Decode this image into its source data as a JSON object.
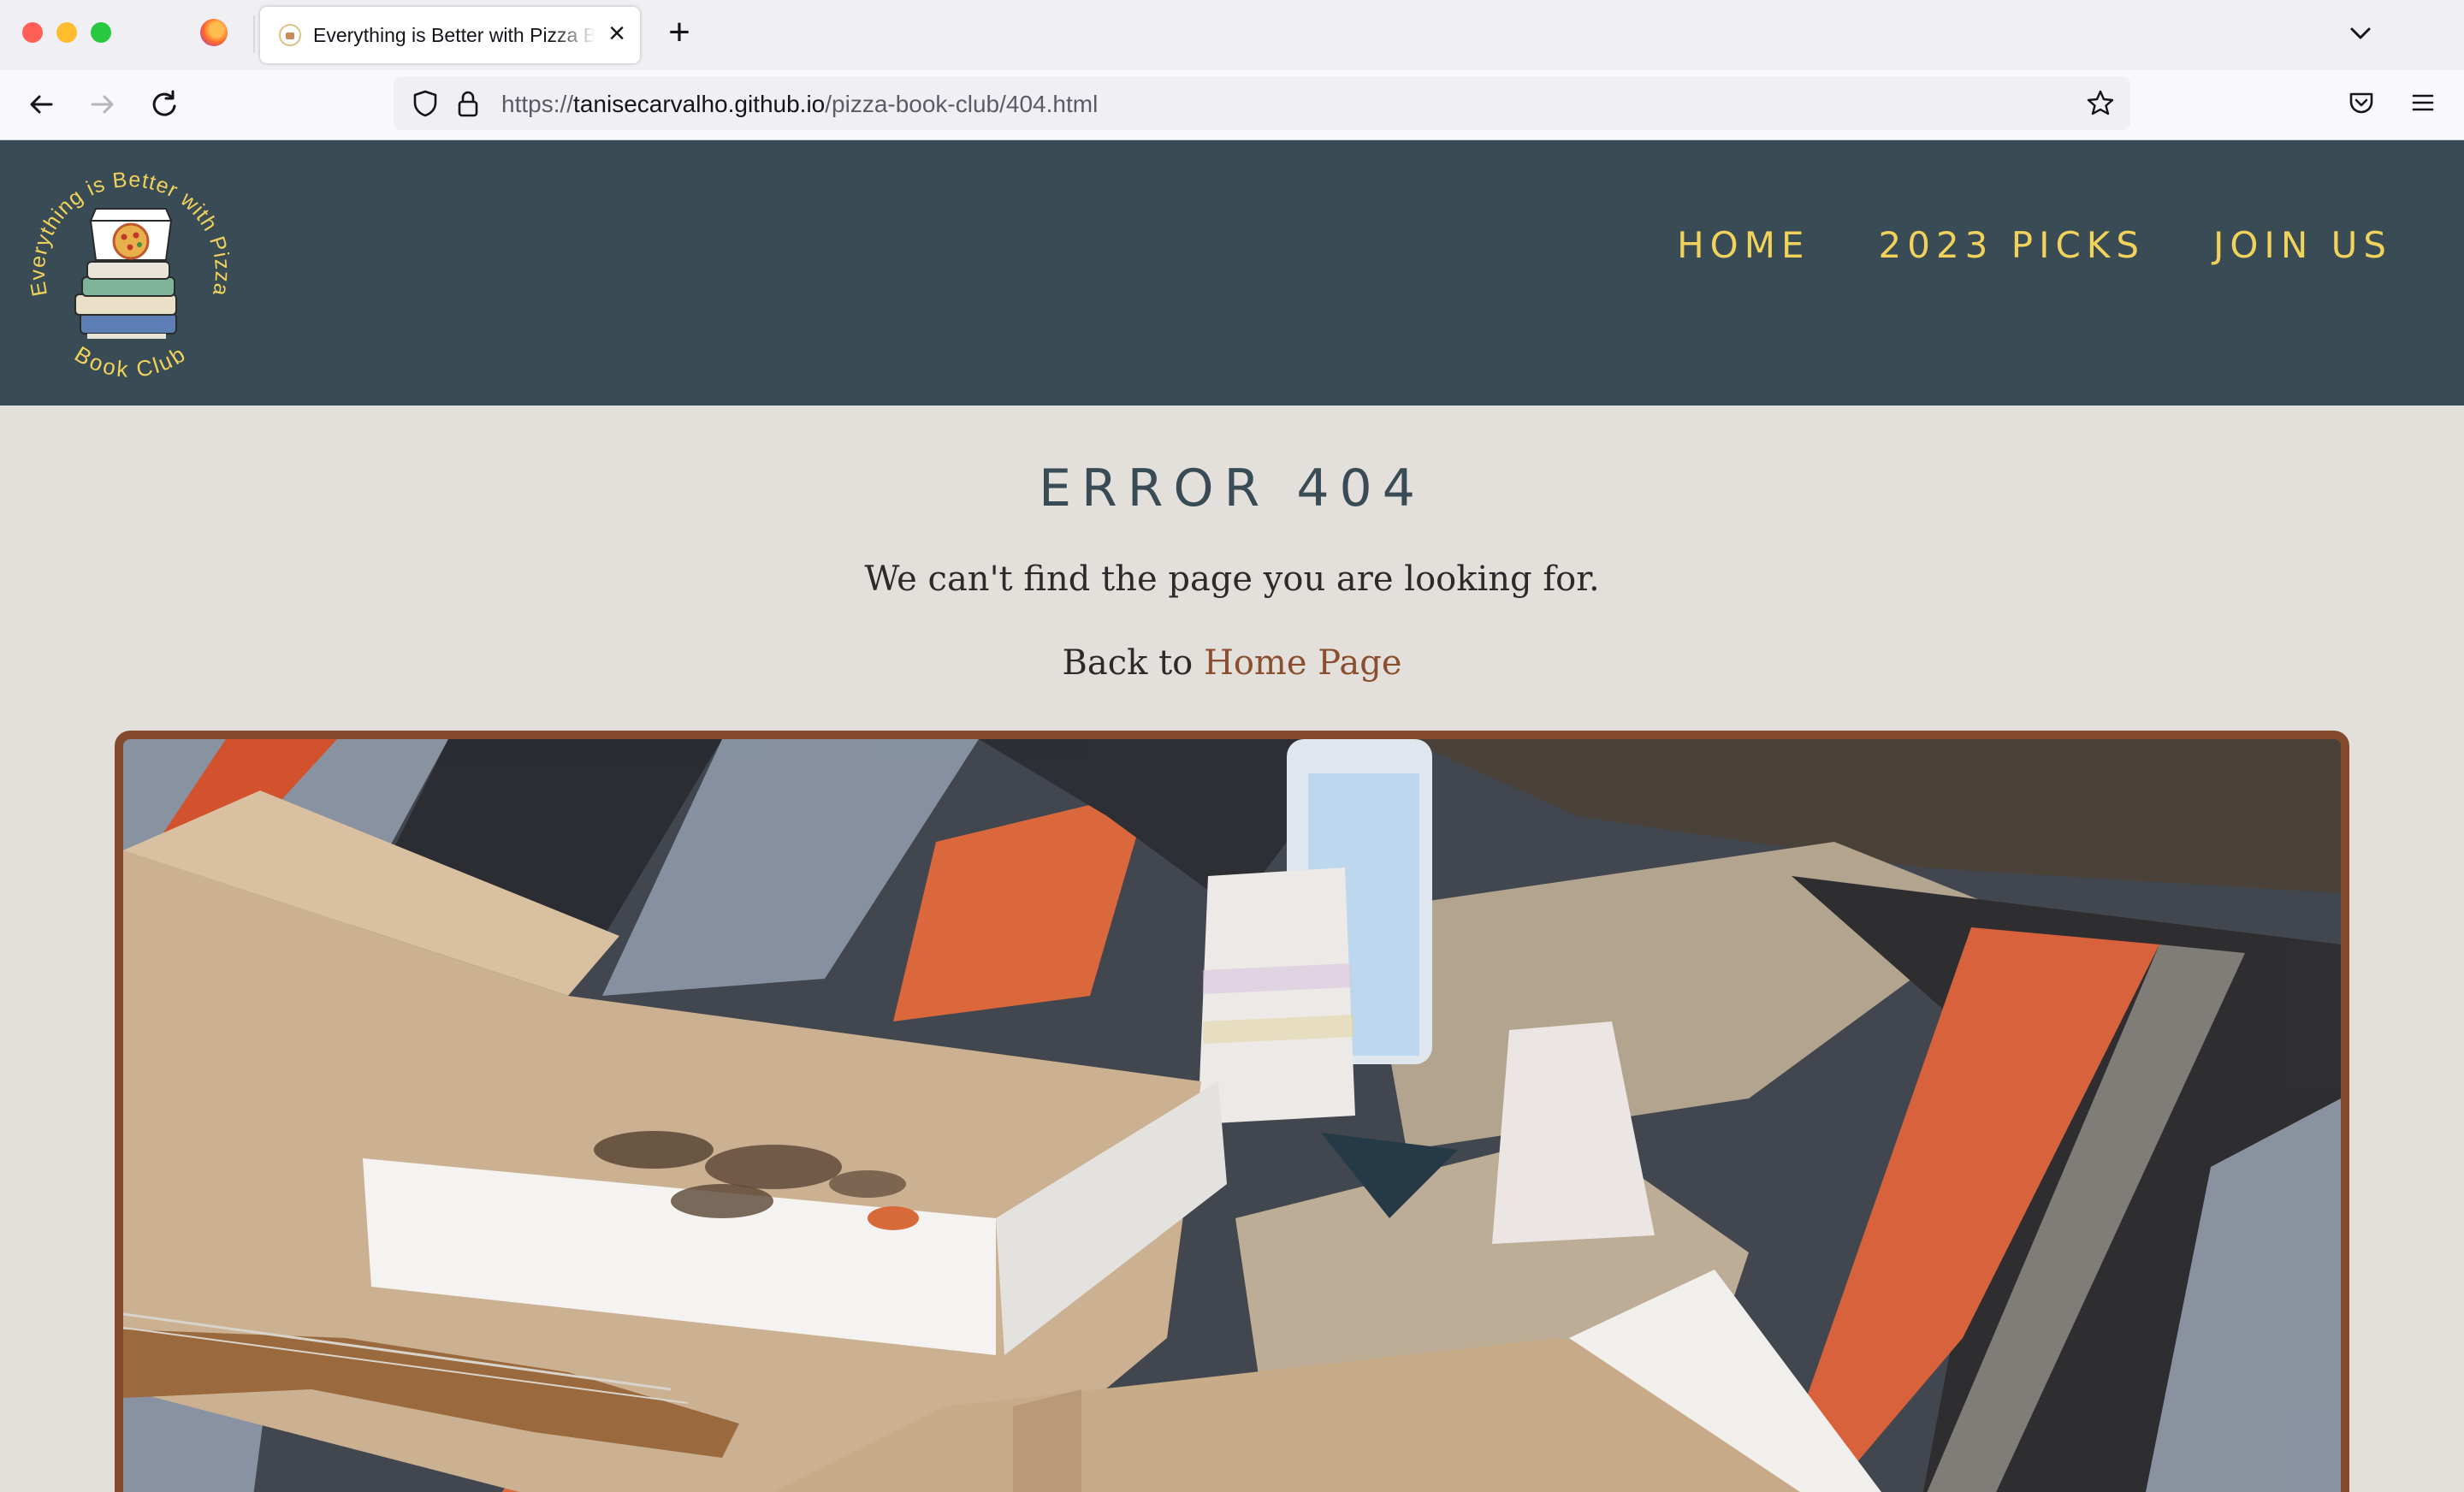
{
  "browser": {
    "tab_title": "Everything is Better with Pizza Book Club",
    "tab_close": "×",
    "new_tab": "+",
    "url_scheme": "https://",
    "url_host": "tanisecarvalho.github.io",
    "url_path": "/pizza-book-club/404.html"
  },
  "site": {
    "logo_text_top": "Everything is Better with Pizza",
    "logo_text_bottom": "Book Club",
    "nav": {
      "home": "HOME",
      "picks": "2023 PICKS",
      "join": "JOIN US"
    }
  },
  "main": {
    "title": "ERROR 404",
    "message": "We can't find the page you are looking for.",
    "back_prefix": "Back to ",
    "back_link": "Home Page"
  },
  "colors": {
    "header_bg": "#394b55",
    "nav_text": "#f1d25b",
    "page_bg": "#e3e0dc",
    "link": "#8a4f2f",
    "photo_border": "#834a2e"
  }
}
